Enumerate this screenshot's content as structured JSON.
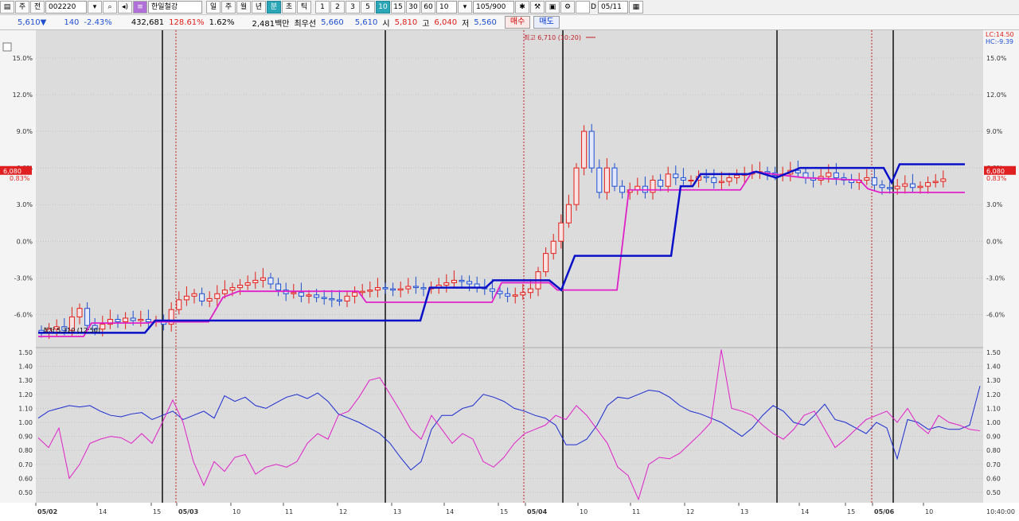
{
  "toolbar": {
    "left_icon": "chart-layout-icon",
    "market": "주",
    "mode": "전",
    "code": "002220",
    "stock_name": "한일철강",
    "periods": [
      "일",
      "주",
      "월",
      "년",
      "분",
      "초",
      "틱"
    ],
    "period_active": "분",
    "intervals": [
      "1",
      "2",
      "3",
      "5",
      "10",
      "15",
      "30",
      "60"
    ],
    "interval_active": "10",
    "count_select": "10",
    "range": "105/900",
    "date_checkbox_label": "D",
    "date": "05/11"
  },
  "info": {
    "price": "5,610▼",
    "change": "140",
    "change_pct": "-2.43%",
    "volume": "432,681",
    "volume_ratio": "128.61%",
    "turnover": "1.62%",
    "amount": "2,481백만",
    "best_ask_label": "최우선",
    "best_ask": "5,660",
    "best_bid": "5,610",
    "open_label": "시",
    "open": "5,810",
    "high_label": "고",
    "high": "6,040",
    "low_label": "저",
    "low": "5,560",
    "buy_label": "매수",
    "sell_label": "매도"
  },
  "chart": {
    "y_ticks_top": [
      "15.0%",
      "12.0%",
      "9.0%",
      "6.0%",
      "3.0%",
      "0.0%",
      "-3.0%",
      "-6.0%"
    ],
    "y_ticks_bottom": [
      "1.50",
      "1.40",
      "1.30",
      "1.20",
      "1.10",
      "1.00",
      "0.90",
      "0.80",
      "0.70",
      "0.60",
      "0.50"
    ],
    "x_labels": [
      "05/02",
      "14",
      "15",
      "05/03",
      "10",
      "11",
      "12",
      "13",
      "14",
      "15",
      "05/04",
      "10",
      "11",
      "12",
      "13",
      "14",
      "15",
      "05/06",
      "10"
    ],
    "current_price": "6,080",
    "current_pct": "0.83%",
    "legend_lc": "LC:14.50",
    "legend_hc": "HC:-9.39",
    "high_annotation": "최고 6,710 (10:20)",
    "low_annotation": "최저 5,310 (12:50)",
    "time": "10:40:00",
    "colors": {
      "up": "#e0201c",
      "down": "#1f4fd0",
      "pink": "#e020c8",
      "navy": "#0a10c8",
      "grid": "#c4c4c4",
      "bg": "#dcdcdc"
    }
  }
}
